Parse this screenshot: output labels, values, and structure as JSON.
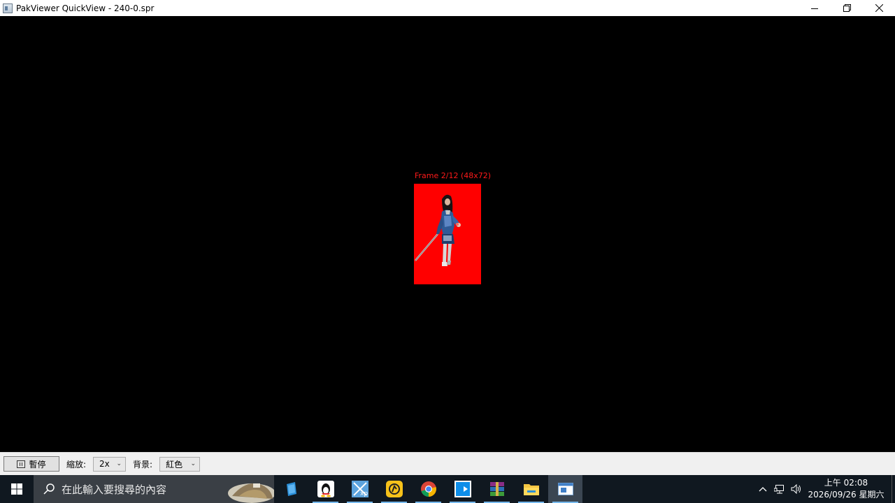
{
  "window": {
    "title": "PakViewer QuickView - 240-0.spr"
  },
  "viewer": {
    "frame_label": "Frame 2/12 (48x72)",
    "background_color": "#ff0000"
  },
  "controls": {
    "pause_label": "暫停",
    "zoom_label": "縮放:",
    "zoom_value": "2x",
    "bg_label": "背景:",
    "bg_value": "紅色"
  },
  "taskbar": {
    "search_placeholder": "在此輸入要搜尋的內容",
    "apps": [
      "notes-app-icon",
      "qq-icon",
      "xp-app-icon",
      "yellow-app-icon",
      "chrome-icon",
      "teamviewer-icon",
      "winrar-icon",
      "file-explorer-icon",
      "pakviewer-icon"
    ],
    "clock_time": "上午 02:08",
    "clock_date": "2026/09/26 星期六"
  }
}
